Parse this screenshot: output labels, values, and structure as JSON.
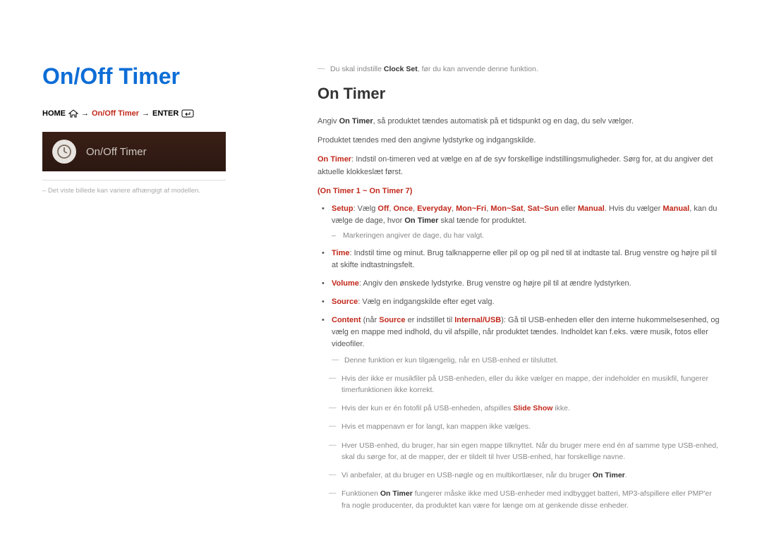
{
  "left": {
    "title": "On/Off Timer",
    "bc_home": "HOME",
    "bc_arrow": "→",
    "bc_mid": "On/Off Timer",
    "bc_enter": "ENTER",
    "tile_label": "On/Off Timer",
    "caption_prefix": "– ",
    "caption": "Det viste billede kan variere afhængigt af modellen."
  },
  "right": {
    "top_note_pre": "Du skal indstille ",
    "top_note_bold": "Clock Set",
    "top_note_post": ", før du kan anvende denne funktion.",
    "section_title": "On Timer",
    "p1_pre": "Angiv ",
    "p1_bold": "On Timer",
    "p1_post": ", så produktet tændes automatisk på et tidspunkt og en dag, du selv vælger.",
    "p2": "Produktet tændes med den angivne lydstyrke og indgangskilde.",
    "p3_bold": "On Timer",
    "p3_post": ": Indstil on-timeren ved at vælge en af de syv forskellige indstillingsmuligheder. Sørg for, at du angiver det aktuelle klokkeslæt først.",
    "group": "(On Timer 1 ~ On Timer 7)",
    "bul1": {
      "label": "Setup",
      "t1": ": Vælg ",
      "o1": "Off",
      "o2": "Once",
      "o3": "Everyday",
      "o4": "Mon~Fri",
      "o5": "Mon~Sat",
      "o6": "Sat~Sun",
      "t2": " eller ",
      "o7": "Manual",
      "t3": ". Hvis du vælger ",
      "o8": "Manual",
      "t4": ", kan du vælge de dage, hvor ",
      "o9": "On Timer",
      "t5": " skal tænde for produktet.",
      "sub": "Markeringen angiver de dage, du har valgt."
    },
    "bul2": {
      "label": "Time",
      "text": ": Indstil time og minut. Brug talknapperne eller pil op og pil ned til at indtaste tal. Brug venstre og højre pil til at skifte indtastningsfelt."
    },
    "bul3": {
      "label": "Volume",
      "text": ": Angiv den ønskede lydstyrke. Brug venstre og højre pil til at ændre lydstyrken."
    },
    "bul4": {
      "label": "Source",
      "text": ": Vælg en indgangskilde efter eget valg."
    },
    "bul5": {
      "label": "Content",
      "t1": " (når ",
      "b1": "Source",
      "t2": " er indstillet til ",
      "b2": "Internal/USB",
      "t3": "): Gå til USB-enheden eller den interne hukommelsesenhed, og vælg en mappe med indhold, du vil afspille, når produktet tændes. Indholdet kan f.eks. være musik, fotos eller videofiler.",
      "sub": "Denne funktion er kun tilgængelig, når en USB-enhed er tilsluttet."
    },
    "n1": "Hvis der ikke er musikfiler på USB-enheden, eller du ikke vælger en mappe, der indeholder en musikfil, fungerer timerfunktionen ikke korrekt.",
    "n2_pre": "Hvis der kun er én fotofil på USB-enheden, afspilles ",
    "n2_bold": "Slide Show",
    "n2_post": " ikke.",
    "n3": "Hvis et mappenavn er for langt, kan mappen ikke vælges.",
    "n4": "Hver USB-enhed, du bruger, har sin egen mappe tilknyttet. Når du bruger mere end én af samme type USB-enhed, skal du sørge for, at de mapper, der er tildelt til hver USB-enhed, har forskellige navne.",
    "n5_pre": "Vi anbefaler, at du bruger en USB-nøgle og en multikortlæser, når du bruger ",
    "n5_bold": "On Timer",
    "n5_post": ".",
    "n6_pre": "Funktionen ",
    "n6_bold": "On Timer",
    "n6_post": " fungerer måske ikke med USB-enheder med indbygget batteri, MP3-afspillere eller PMP'er fra nogle producenter, da produktet kan være for længe om at genkende disse enheder."
  }
}
